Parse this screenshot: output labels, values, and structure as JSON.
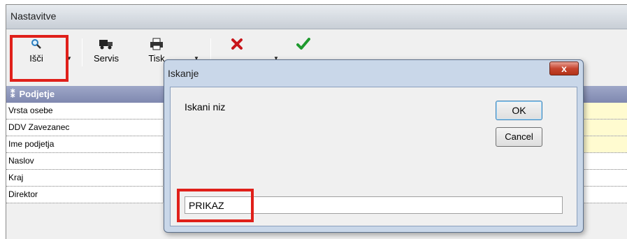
{
  "window": {
    "title": "Nastavitve"
  },
  "toolbar": {
    "search_label": "Išči",
    "service_label": "Servis",
    "print_label": "Tisk"
  },
  "grid": {
    "header": "Podjetje",
    "rows": [
      {
        "label": "Vrsta osebe"
      },
      {
        "label": "DDV Zavezanec"
      },
      {
        "label": "Ime podjetja"
      },
      {
        "label": "Naslov"
      },
      {
        "label": "Kraj"
      },
      {
        "label": "Direktor"
      }
    ]
  },
  "dialog": {
    "title": "Iskanje",
    "close_label": "x",
    "prompt": "Iskani niz",
    "ok_label": "OK",
    "cancel_label": "Cancel",
    "input_value": "PRIKAZ"
  },
  "colors": {
    "highlight": "#e0201a",
    "header": "#8790b8",
    "yellow_field": "#fffbd0"
  }
}
